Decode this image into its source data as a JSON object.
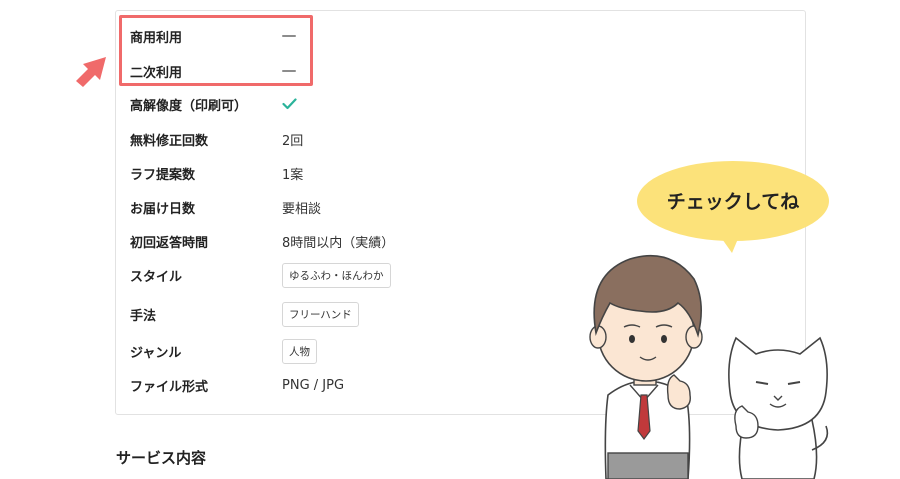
{
  "spec_table": {
    "rows": [
      {
        "label": "商用利用",
        "type": "none"
      },
      {
        "label": "二次利用",
        "type": "none"
      },
      {
        "label": "高解像度（印刷可）",
        "type": "check"
      },
      {
        "label": "無料修正回数",
        "value": "2回"
      },
      {
        "label": "ラフ提案数",
        "value": "1案"
      },
      {
        "label": "お届け日数",
        "value": "要相談"
      },
      {
        "label": "初回返答時間",
        "value": "8時間以内（実績）"
      },
      {
        "label": "スタイル",
        "tag": "ゆるふわ・ほんわか"
      },
      {
        "label": "手法",
        "tag": "フリーハンド"
      },
      {
        "label": "ジャンル",
        "tag": "人物"
      },
      {
        "label": "ファイル形式",
        "value": "PNG / JPG"
      }
    ]
  },
  "section_title": "サービス内容",
  "speech_bubble": "チェックしてね",
  "colors": {
    "highlight": "#f06a6a",
    "check": "#2bb39a",
    "bubble": "#fce27a"
  }
}
